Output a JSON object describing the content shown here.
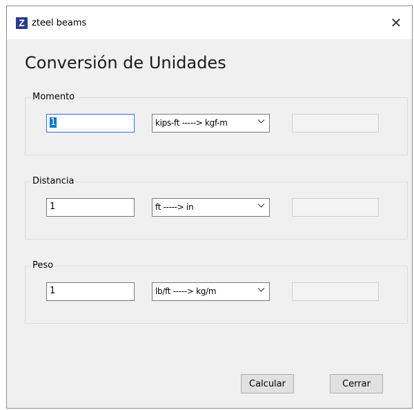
{
  "window": {
    "title": "zteel beams",
    "app_icon_letter": "Z",
    "close_glyph": "✕"
  },
  "heading": "Conversión de Unidades",
  "groups": {
    "momento": {
      "label": "Momento",
      "value": "1",
      "conversion": "kips-ft -----> kgf-m",
      "result": ""
    },
    "distancia": {
      "label": "Distancia",
      "value": "1",
      "conversion": "ft -----> in",
      "result": ""
    },
    "peso": {
      "label": "Peso",
      "value": "1",
      "conversion": "lb/ft -----> kg/m",
      "result": ""
    }
  },
  "buttons": {
    "calcular": "Calcular",
    "cerrar": "Cerrar"
  },
  "icons": {
    "app": "app-logo-icon",
    "close": "close-icon",
    "dropdown": "chevron-down-icon"
  },
  "colors": {
    "window_bg": "#f0f0f0",
    "titlebar_bg": "#ffffff",
    "selection": "#0078d7",
    "app_icon": "#2b3a8f"
  }
}
